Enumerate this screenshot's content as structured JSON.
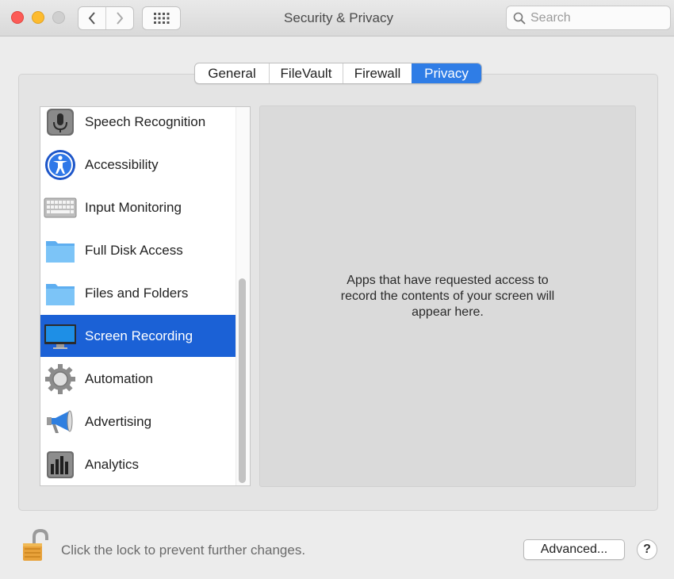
{
  "window": {
    "title": "Security & Privacy",
    "search_placeholder": "Search"
  },
  "tabs": [
    {
      "label": "General",
      "selected": false
    },
    {
      "label": "FileVault",
      "selected": false
    },
    {
      "label": "Firewall",
      "selected": false
    },
    {
      "label": "Privacy",
      "selected": true
    }
  ],
  "privacy_list": {
    "items": [
      {
        "label": "Speech Recognition",
        "icon": "microphone-icon",
        "selected": false
      },
      {
        "label": "Accessibility",
        "icon": "accessibility-icon",
        "selected": false
      },
      {
        "label": "Input Monitoring",
        "icon": "keyboard-icon",
        "selected": false
      },
      {
        "label": "Full Disk Access",
        "icon": "folder-icon",
        "selected": false
      },
      {
        "label": "Files and Folders",
        "icon": "folder-icon",
        "selected": false
      },
      {
        "label": "Screen Recording",
        "icon": "display-icon",
        "selected": true
      },
      {
        "label": "Automation",
        "icon": "gear-icon",
        "selected": false
      },
      {
        "label": "Advertising",
        "icon": "megaphone-icon",
        "selected": false
      },
      {
        "label": "Analytics",
        "icon": "bar-chart-icon",
        "selected": false
      }
    ]
  },
  "detail": {
    "message": "Apps that have requested access to record the contents of your screen will appear here."
  },
  "footer": {
    "lock_text": "Click the lock to prevent further changes.",
    "advanced_label": "Advanced...",
    "help_label": "?"
  },
  "colors": {
    "accent": "#2f7de6",
    "selection": "#1b61d6",
    "close": "#fc5b57",
    "minimize": "#fdbb2e"
  }
}
